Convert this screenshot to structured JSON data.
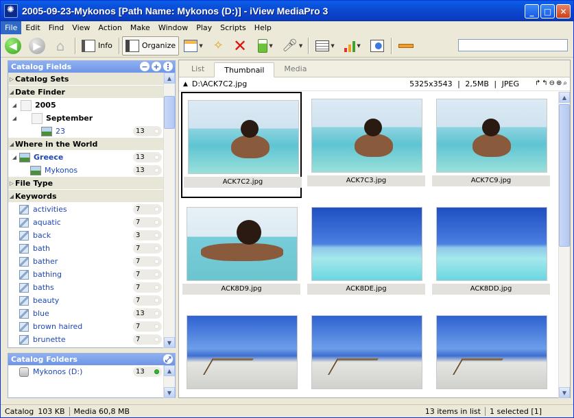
{
  "window": {
    "title": "2005-09-23-Mykonos [Path Name: Mykonos (D:)] - iView MediaPro 3"
  },
  "menu": [
    "File",
    "Edit",
    "Find",
    "View",
    "Action",
    "Make",
    "Window",
    "Play",
    "Scripts",
    "Help"
  ],
  "toolbar": {
    "info_label": "Info",
    "organize_label": "Organize",
    "search_value": ""
  },
  "catalog_fields": {
    "title": "Catalog Fields",
    "catalog_sets": "Catalog Sets",
    "date_finder": "Date Finder",
    "year": "2005",
    "month": "September",
    "day": {
      "label": "23",
      "count": "13"
    },
    "where": "Where in the World",
    "country": {
      "label": "Greece",
      "count": "13"
    },
    "city": {
      "label": "Mykonos",
      "count": "13"
    },
    "file_type": "File Type",
    "keywords_title": "Keywords",
    "keywords": [
      {
        "label": "activities",
        "count": "7"
      },
      {
        "label": "aquatic",
        "count": "7"
      },
      {
        "label": "back",
        "count": "3"
      },
      {
        "label": "bath",
        "count": "7"
      },
      {
        "label": "bather",
        "count": "7"
      },
      {
        "label": "bathing",
        "count": "7"
      },
      {
        "label": "baths",
        "count": "7"
      },
      {
        "label": "beauty",
        "count": "7"
      },
      {
        "label": "blue",
        "count": "13"
      },
      {
        "label": "brown haired",
        "count": "7"
      },
      {
        "label": "brunette",
        "count": "7"
      }
    ]
  },
  "catalog_folders": {
    "title": "Catalog Folders",
    "items": [
      {
        "label": "Mykonos (D:)",
        "count": "13"
      }
    ]
  },
  "tabs": [
    "List",
    "Thumbnail",
    "Media"
  ],
  "active_tab": "Thumbnail",
  "path": {
    "file": "D:\\ACK7C2.jpg",
    "dimensions": "5325x3543",
    "size": "2,5MB",
    "format": "JPEG"
  },
  "thumbnails": [
    {
      "name": "ACK7C2.jpg",
      "style": "pool1",
      "selected": true
    },
    {
      "name": "ACK7C3.jpg",
      "style": "pool1",
      "selected": false
    },
    {
      "name": "ACK7C9.jpg",
      "style": "pool1",
      "selected": false
    },
    {
      "name": "ACK8D9.jpg",
      "style": "pool2",
      "selected": false
    },
    {
      "name": "ACK8DE.jpg",
      "style": "sky1",
      "selected": false
    },
    {
      "name": "ACK8DD.jpg",
      "style": "sky1",
      "selected": false
    },
    {
      "name": "",
      "style": "beach",
      "selected": false
    },
    {
      "name": "",
      "style": "beach",
      "selected": false
    },
    {
      "name": "",
      "style": "beach",
      "selected": false
    }
  ],
  "status": {
    "catalog": "Catalog",
    "catalog_size": "103 KB",
    "media": "Media 60,8 MB",
    "items": "13 items in list",
    "selected": "1 selected [1]"
  },
  "colors": {
    "title_blue": "#0A4BD4",
    "panel_head": "#7EA2EA",
    "link": "#1D46B8",
    "selection": "#316AC5"
  }
}
